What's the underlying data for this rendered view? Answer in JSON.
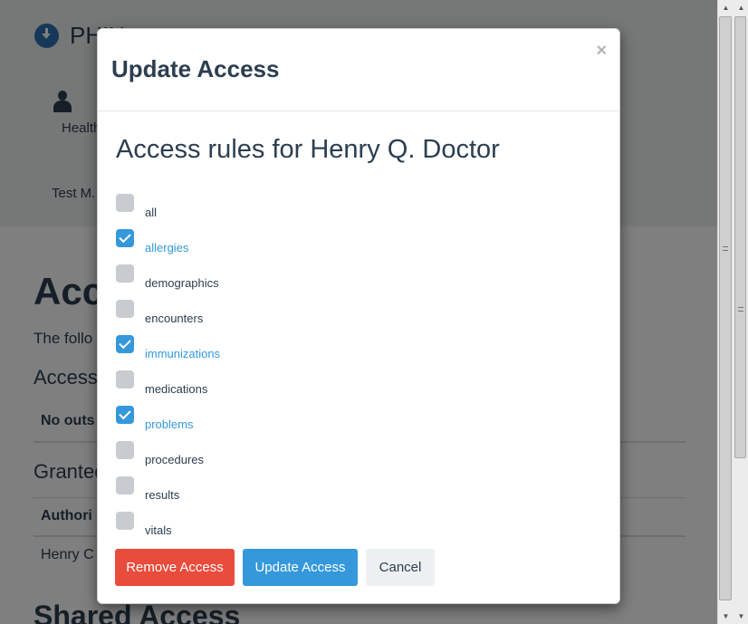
{
  "background": {
    "brand": "PHIX",
    "nav_item": "Health",
    "user_item": "Test M.",
    "page_title": "Access",
    "intro_text": "The follo",
    "section1_title": "Access",
    "section1_empty": "No outs",
    "section2_title": "Granted",
    "column_header": "Authori",
    "row_value": "Henry C",
    "section3_title": "Shared Access"
  },
  "modal": {
    "title": "Update Access",
    "close_label": "×",
    "heading": "Access rules for Henry Q. Doctor",
    "rules": [
      {
        "label": "all",
        "checked": false
      },
      {
        "label": "allergies",
        "checked": true
      },
      {
        "label": "demographics",
        "checked": false
      },
      {
        "label": "encounters",
        "checked": false
      },
      {
        "label": "immunizations",
        "checked": true
      },
      {
        "label": "medications",
        "checked": false
      },
      {
        "label": "problems",
        "checked": true
      },
      {
        "label": "procedures",
        "checked": false
      },
      {
        "label": "results",
        "checked": false
      },
      {
        "label": "vitals",
        "checked": false
      }
    ],
    "buttons": {
      "remove": "Remove Access",
      "update": "Update Access",
      "cancel": "Cancel"
    }
  },
  "colors": {
    "primary": "#3498db",
    "danger": "#e74c3c",
    "text": "#2c3e50",
    "unchecked": "#c8ccd0"
  }
}
